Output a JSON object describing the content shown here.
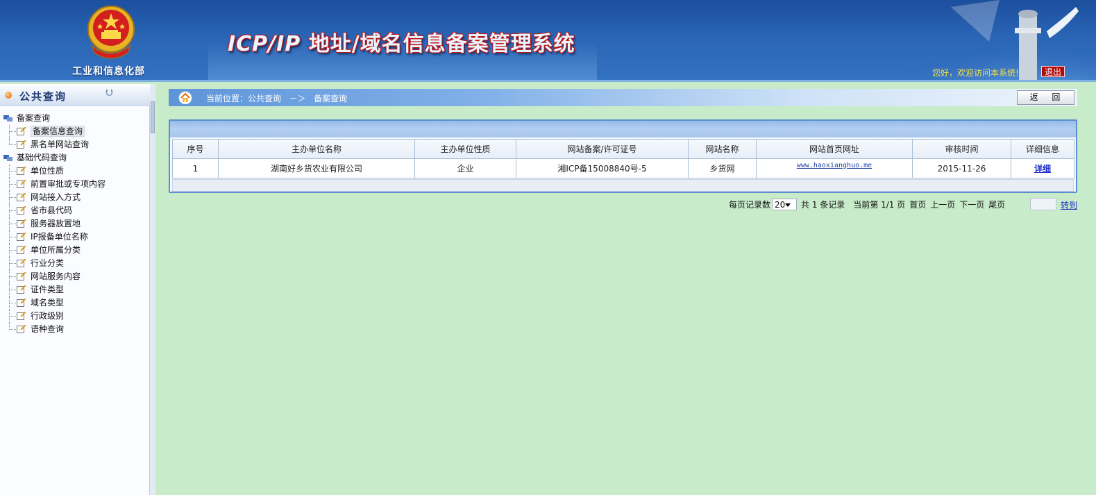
{
  "header": {
    "ministry": "工业和信息化部",
    "title_prefix": "ICP/IP",
    "title_rest": " 地址/域名信息备案管理系统",
    "welcome": "您好，欢迎访问本系统!",
    "logout": "退出"
  },
  "sidebar": {
    "title": "公共查询",
    "groups": [
      {
        "label": "备案查询",
        "items": [
          "备案信息查询",
          "黑名单网站查询"
        ]
      },
      {
        "label": "基础代码查询",
        "items": [
          "单位性质",
          "前置审批或专项内容",
          "网站接入方式",
          "省市县代码",
          "服务器放置地",
          "IP报备单位名称",
          "单位所属分类",
          "行业分类",
          "网站服务内容",
          "证件类型",
          "域名类型",
          "行政级别",
          "语种查询"
        ]
      }
    ],
    "active_item": "备案信息查询"
  },
  "breadcrumb": {
    "label": "当前位置：",
    "level1": "公共查询",
    "sep": "－＞",
    "level2": "备案查询"
  },
  "back_button": "返 回",
  "table": {
    "columns": [
      "序号",
      "主办单位名称",
      "主办单位性质",
      "网站备案/许可证号",
      "网站名称",
      "网站首页网址",
      "审核时间",
      "详细信息"
    ],
    "rows": [
      [
        "1",
        "湖南好乡货农业有限公司",
        "企业",
        "湘ICP备15008840号-5",
        "乡货网",
        "www.haoxianghuo.me",
        "2015-11-26",
        "详细"
      ]
    ]
  },
  "pager": {
    "per_page_label": "每页记录数",
    "per_page_value": "20",
    "total": "共 1 条记录",
    "current": "当前第 1/1 页",
    "first": "首页",
    "prev": "上一页",
    "next": "下一页",
    "last": "尾页",
    "goto": "转到"
  },
  "colors": {
    "header_blue": "#2a64b5",
    "page_bg": "#c8ecca",
    "title_red": "#c21616",
    "link": "#1b2cc8",
    "welcome": "#f6e04a"
  }
}
